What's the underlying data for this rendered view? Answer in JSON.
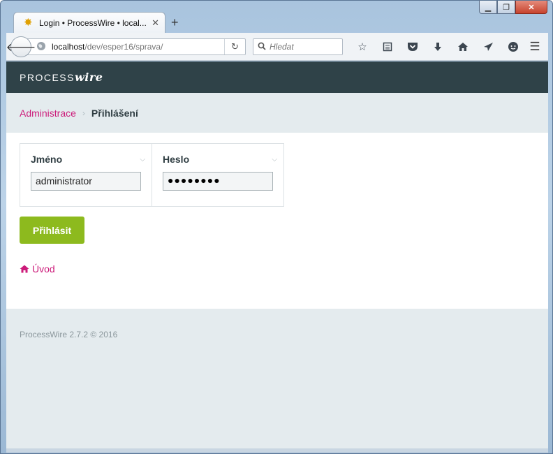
{
  "window": {
    "minimize": "▁",
    "maximize": "❐",
    "close": "✕"
  },
  "tab": {
    "favicon": "processwire-favicon-icon",
    "title": "Login • ProcessWire • local...",
    "close": "✕",
    "new_tab": "+"
  },
  "nav": {
    "back": "back-arrow-icon",
    "url_host": "localhost",
    "url_path": "/dev/esper16/sprava/",
    "search_placeholder": "Hledat",
    "toolbar_icons": [
      "star-icon",
      "reading-list-icon",
      "pocket-icon",
      "download-icon",
      "home-icon",
      "send-icon",
      "chat-icon"
    ]
  },
  "site": {
    "logo_prefix": "PROCESS",
    "logo_suffix": "wire"
  },
  "breadcrumbs": {
    "parent": "Administrace",
    "separator": "›",
    "current": "Přihlášení"
  },
  "form": {
    "username": {
      "label": "Jméno",
      "value": "administrator"
    },
    "password": {
      "label": "Heslo",
      "value": "●●●●●●●●"
    },
    "submit_label": "Přihlásit",
    "home_link": "Úvod"
  },
  "footer": {
    "text": "ProcessWire 2.7.2 © 2016"
  },
  "colors": {
    "masthead": "#2f4248",
    "link": "#cc1b7a",
    "button": "#8dba1e",
    "light_bg": "#e4ebee"
  }
}
